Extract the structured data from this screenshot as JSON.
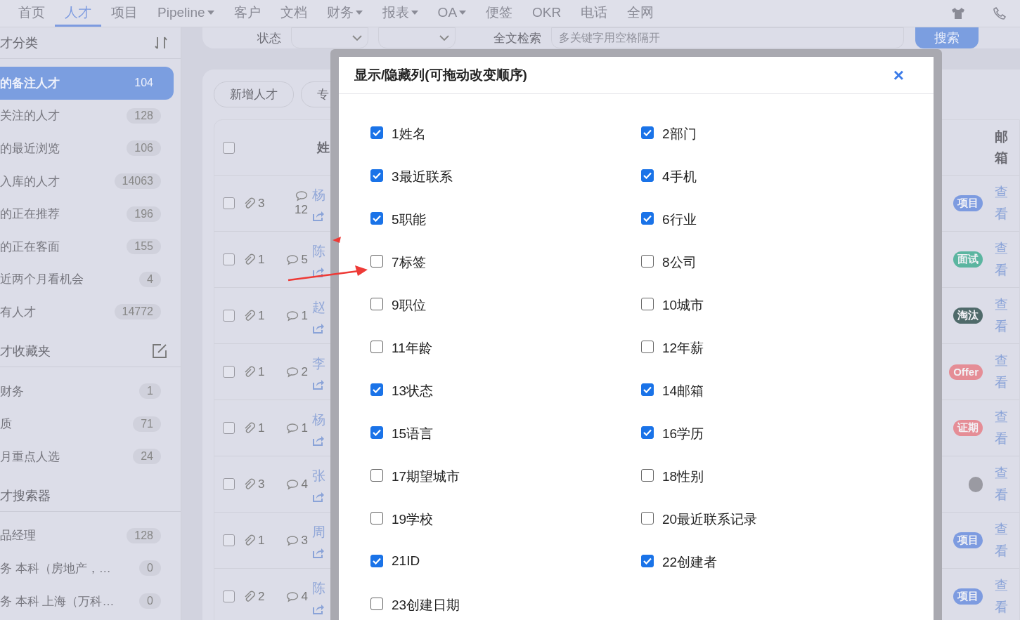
{
  "nav": {
    "items": [
      {
        "label": "首页",
        "selected": false,
        "dropdown": false
      },
      {
        "label": "人才",
        "selected": true,
        "dropdown": false
      },
      {
        "label": "项目",
        "selected": false,
        "dropdown": false
      },
      {
        "label": "Pipeline",
        "selected": false,
        "dropdown": true
      },
      {
        "label": "客户",
        "selected": false,
        "dropdown": false
      },
      {
        "label": "文档",
        "selected": false,
        "dropdown": false
      },
      {
        "label": "财务",
        "selected": false,
        "dropdown": true
      },
      {
        "label": "报表",
        "selected": false,
        "dropdown": true
      },
      {
        "label": "OA",
        "selected": false,
        "dropdown": true
      },
      {
        "label": "便签",
        "selected": false,
        "dropdown": false
      },
      {
        "label": "OKR",
        "selected": false,
        "dropdown": false
      },
      {
        "label": "电话",
        "selected": false,
        "dropdown": false
      },
      {
        "label": "全网",
        "selected": false,
        "dropdown": false
      }
    ]
  },
  "sidebar": {
    "sections": [
      {
        "title": "才分类",
        "kind": "sort",
        "items": [
          {
            "label": "的备注人才",
            "count": "104",
            "selected": true
          },
          {
            "label": "关注的人才",
            "count": "128",
            "selected": false
          },
          {
            "label": "的最近浏览",
            "count": "106",
            "selected": false
          },
          {
            "label": "入库的人才",
            "count": "14063",
            "selected": false
          },
          {
            "label": "的正在推荐",
            "count": "196",
            "selected": false
          },
          {
            "label": "的正在客面",
            "count": "155",
            "selected": false
          },
          {
            "label": "近两个月看机会",
            "count": "4",
            "selected": false
          },
          {
            "label": "有人才",
            "count": "14772",
            "selected": false
          }
        ]
      },
      {
        "title": "才收藏夹",
        "kind": "edit",
        "items": [
          {
            "label": "财务",
            "count": "1",
            "selected": false
          },
          {
            "label": "质",
            "count": "71",
            "selected": false
          },
          {
            "label": "月重点人选",
            "count": "24",
            "selected": false
          }
        ]
      },
      {
        "title": "才搜索器",
        "kind": "plain",
        "items": [
          {
            "label": "品经理",
            "count": "128",
            "selected": false
          },
          {
            "label": "务 本科（房地产，…",
            "count": "0",
            "selected": false
          },
          {
            "label": "务 本科 上海（万科…",
            "count": "0",
            "selected": false
          }
        ]
      }
    ]
  },
  "filter": {
    "status_label": "状态",
    "search_label": "全文检索",
    "search_placeholder": "多关键字用空格隔开",
    "search_button": "搜索"
  },
  "toolbar": {
    "buttons": [
      "新增人才",
      "专"
    ]
  },
  "table": {
    "columns": {
      "name": "姓",
      "email": "邮箱"
    },
    "select_all_checked": false,
    "rows": [
      {
        "checked": false,
        "attachments": "3",
        "comments": "12",
        "name": "杨",
        "status": "项目",
        "color": "#7d9be0",
        "email": "查看"
      },
      {
        "checked": false,
        "attachments": "1",
        "comments": "5",
        "name": "陈",
        "status": "面试",
        "color": "#5bb5a0",
        "email": "查看"
      },
      {
        "checked": false,
        "attachments": "1",
        "comments": "1",
        "name": "赵",
        "status": "淘汰",
        "color": "#4f6a6a",
        "email": "查看"
      },
      {
        "checked": false,
        "attachments": "1",
        "comments": "2",
        "name": "李",
        "status": "Offer",
        "color": "#e58d96",
        "email": "查看"
      },
      {
        "checked": false,
        "attachments": "1",
        "comments": "1",
        "name": "杨",
        "status": "证期",
        "color": "#e58d96",
        "email": "查看"
      },
      {
        "checked": false,
        "attachments": "3",
        "comments": "4",
        "name": "张",
        "color": "#9a9aa2",
        "email": "查看"
      },
      {
        "checked": false,
        "attachments": "1",
        "comments": "3",
        "name": "周",
        "status": "项目",
        "color": "#7d9be0",
        "email": "查看"
      },
      {
        "checked": false,
        "attachments": "2",
        "comments": "4",
        "name": "陈",
        "status": "项目",
        "color": "#7d9be0",
        "email": "查看"
      }
    ]
  },
  "dialog": {
    "title": "显示/隐藏列(可拖动改变顺序)",
    "close": "×",
    "columns": [
      {
        "label": "1姓名",
        "checked": true
      },
      {
        "label": "2部门",
        "checked": true
      },
      {
        "label": "3最近联系",
        "checked": true
      },
      {
        "label": "4手机",
        "checked": true
      },
      {
        "label": "5职能",
        "checked": true
      },
      {
        "label": "6行业",
        "checked": true
      },
      {
        "label": "7标签",
        "checked": false
      },
      {
        "label": "8公司",
        "checked": false
      },
      {
        "label": "9职位",
        "checked": false
      },
      {
        "label": "10城市",
        "checked": false
      },
      {
        "label": "11年龄",
        "checked": false
      },
      {
        "label": "12年薪",
        "checked": false
      },
      {
        "label": "13状态",
        "checked": true
      },
      {
        "label": "14邮箱",
        "checked": true
      },
      {
        "label": "15语言",
        "checked": true
      },
      {
        "label": "16学历",
        "checked": true
      },
      {
        "label": "17期望城市",
        "checked": false
      },
      {
        "label": "18性别",
        "checked": false
      },
      {
        "label": "19学校",
        "checked": false
      },
      {
        "label": "20最近联系记录",
        "checked": false
      },
      {
        "label": "21ID",
        "checked": true
      },
      {
        "label": "22创建者",
        "checked": true
      },
      {
        "label": "23创建日期",
        "checked": false
      }
    ]
  }
}
